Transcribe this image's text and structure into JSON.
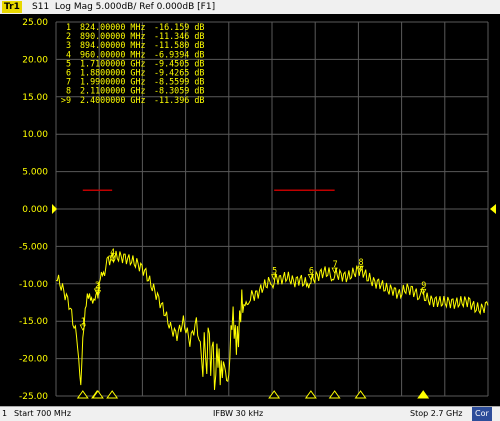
{
  "title_bar": {
    "trace_label": "Tr1",
    "text": "S11  Log Mag 5.000dB/ Ref 0.000dB [F1]"
  },
  "status_bar": {
    "channel": "1",
    "start": "Start 700 MHz",
    "ifbw": "IFBW 30 kHz",
    "stop": "Stop 2.7 GHz",
    "correction": "Cor"
  },
  "colors": {
    "trace": "#ffff00",
    "grid": "#5a5a5a",
    "limit_line": "#c00000",
    "background": "#000000"
  },
  "y_axis_labels": [
    "25.00",
    "20.00",
    "15.00",
    "10.00",
    "5.000",
    "0.000",
    "-5.000",
    "-10.00",
    "-15.00",
    "-20.00",
    "-25.00"
  ],
  "ref_value_label": "0.000",
  "markers": [
    {
      "num": "1",
      "freq": "824.00000 MHz",
      "value": "-16.159 dB"
    },
    {
      "num": "2",
      "freq": "890.00000 MHz",
      "value": "-11.346 dB"
    },
    {
      "num": "3",
      "freq": "894.00000 MHz",
      "value": "-11.580 dB"
    },
    {
      "num": "4",
      "freq": "960.00000 MHz",
      "value": "-6.9394 dB"
    },
    {
      "num": "5",
      "freq": "1.7100000 GHz",
      "value": "-9.4505 dB"
    },
    {
      "num": "6",
      "freq": "1.8800000 GHz",
      "value": "-9.4265 dB"
    },
    {
      "num": "7",
      "freq": "1.9900000 GHz",
      "value": "-8.5599 dB"
    },
    {
      "num": "8",
      "freq": "2.1100000 GHz",
      "value": "-8.3059 dB"
    },
    {
      "num": ">9",
      "freq": "2.4000000 GHz",
      "value": "-11.396 dB"
    }
  ],
  "chart_data": {
    "type": "line",
    "title": "S11  Log Mag 5.000dB/ Ref 0.000dB [F1]",
    "x_unit": "MHz",
    "xlim": [
      700,
      2700
    ],
    "ylim": [
      -25,
      25
    ],
    "y_ticks": [
      25,
      20,
      15,
      10,
      5,
      0,
      -5,
      -10,
      -15,
      -20,
      -25
    ],
    "grid": true,
    "limit_lines": [
      {
        "x": [
          824,
          960
        ],
        "y": 2.5
      },
      {
        "x": [
          1710,
          1990
        ],
        "y": 2.5
      }
    ],
    "marker_points": [
      {
        "x": 824,
        "y": -16.159
      },
      {
        "x": 890,
        "y": -11.346
      },
      {
        "x": 894,
        "y": -11.58
      },
      {
        "x": 960,
        "y": -6.9394
      },
      {
        "x": 1710,
        "y": -9.4505
      },
      {
        "x": 1880,
        "y": -9.4265
      },
      {
        "x": 1990,
        "y": -8.5599
      },
      {
        "x": 2110,
        "y": -8.3059
      },
      {
        "x": 2400,
        "y": -11.396
      }
    ],
    "series": [
      {
        "x": [
          700,
          730,
          760,
          790,
          805,
          815,
          824,
          835,
          845,
          860,
          875,
          890,
          894,
          910,
          930,
          960,
          990,
          1020,
          1050,
          1080,
          1110,
          1140,
          1170,
          1200,
          1230,
          1260,
          1290,
          1320,
          1350,
          1380,
          1410,
          1440,
          1460,
          1480,
          1500,
          1520,
          1540,
          1560,
          1580,
          1600,
          1630,
          1660,
          1690,
          1710,
          1740,
          1770,
          1800,
          1830,
          1860,
          1880,
          1910,
          1940,
          1970,
          1990,
          2020,
          2050,
          2080,
          2110,
          2140,
          2170,
          2200,
          2230,
          2260,
          2290,
          2320,
          2350,
          2380,
          2400,
          2430,
          2460,
          2490,
          2520,
          2550,
          2580,
          2610,
          2640,
          2670,
          2700
        ],
        "y": [
          -9.0,
          -11.0,
          -13.0,
          -16.5,
          -20.0,
          -23.0,
          -16.2,
          -14.0,
          -12.5,
          -11.8,
          -11.5,
          -11.3,
          -11.6,
          -9.0,
          -7.5,
          -6.9,
          -6.4,
          -6.2,
          -6.5,
          -7.2,
          -8.5,
          -10.5,
          -12.0,
          -13.5,
          -15.5,
          -16.5,
          -15.0,
          -18.0,
          -15.5,
          -21.0,
          -17.0,
          -20.0,
          -25.0,
          -17.0,
          -24.0,
          -16.0,
          -14.0,
          -15.0,
          -12.5,
          -11.5,
          -11.0,
          -10.0,
          -9.7,
          -9.5,
          -9.8,
          -9.3,
          -9.6,
          -9.0,
          -9.7,
          -9.4,
          -9.2,
          -8.8,
          -8.9,
          -8.6,
          -8.5,
          -8.7,
          -8.4,
          -8.3,
          -9.5,
          -10.0,
          -9.8,
          -10.3,
          -10.5,
          -11.5,
          -11.0,
          -11.2,
          -11.8,
          -11.4,
          -11.8,
          -12.0,
          -12.5,
          -12.8,
          -13.0,
          -12.5,
          -12.0,
          -12.8,
          -13.2,
          -12.9
        ]
      }
    ]
  }
}
